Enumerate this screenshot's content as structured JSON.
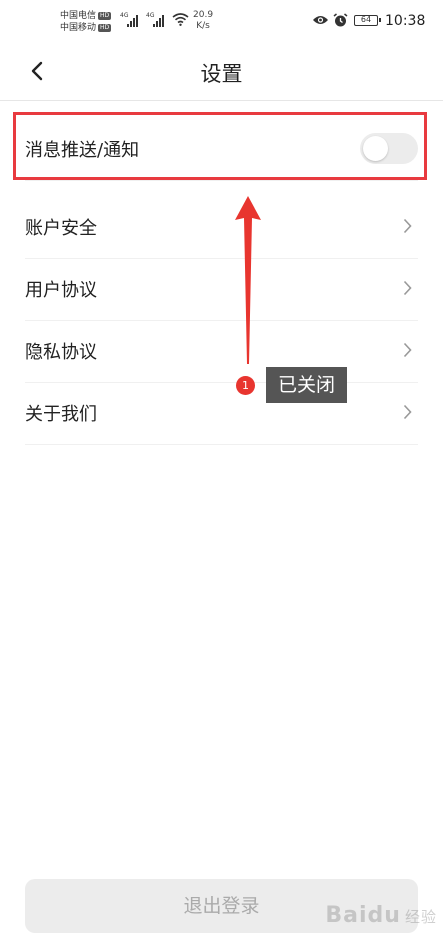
{
  "status_bar": {
    "carrier_1": "中国电信",
    "carrier_2": "中国移动",
    "hd": "HD",
    "network": "4G",
    "speed_value": "20.9",
    "speed_unit": "K/s",
    "battery": "64",
    "time": "10:38"
  },
  "header": {
    "title": "设置"
  },
  "settings": {
    "notification": {
      "label": "消息推送/通知",
      "enabled": false
    },
    "items": [
      {
        "label": "账户安全"
      },
      {
        "label": "用户协议"
      },
      {
        "label": "隐私协议"
      },
      {
        "label": "关于我们"
      }
    ]
  },
  "annotation": {
    "step": "1",
    "text": "已关闭",
    "color": "#e8352f"
  },
  "logout_label": "退出登录",
  "watermark": {
    "brand": "Baidu",
    "suffix": "经验"
  }
}
